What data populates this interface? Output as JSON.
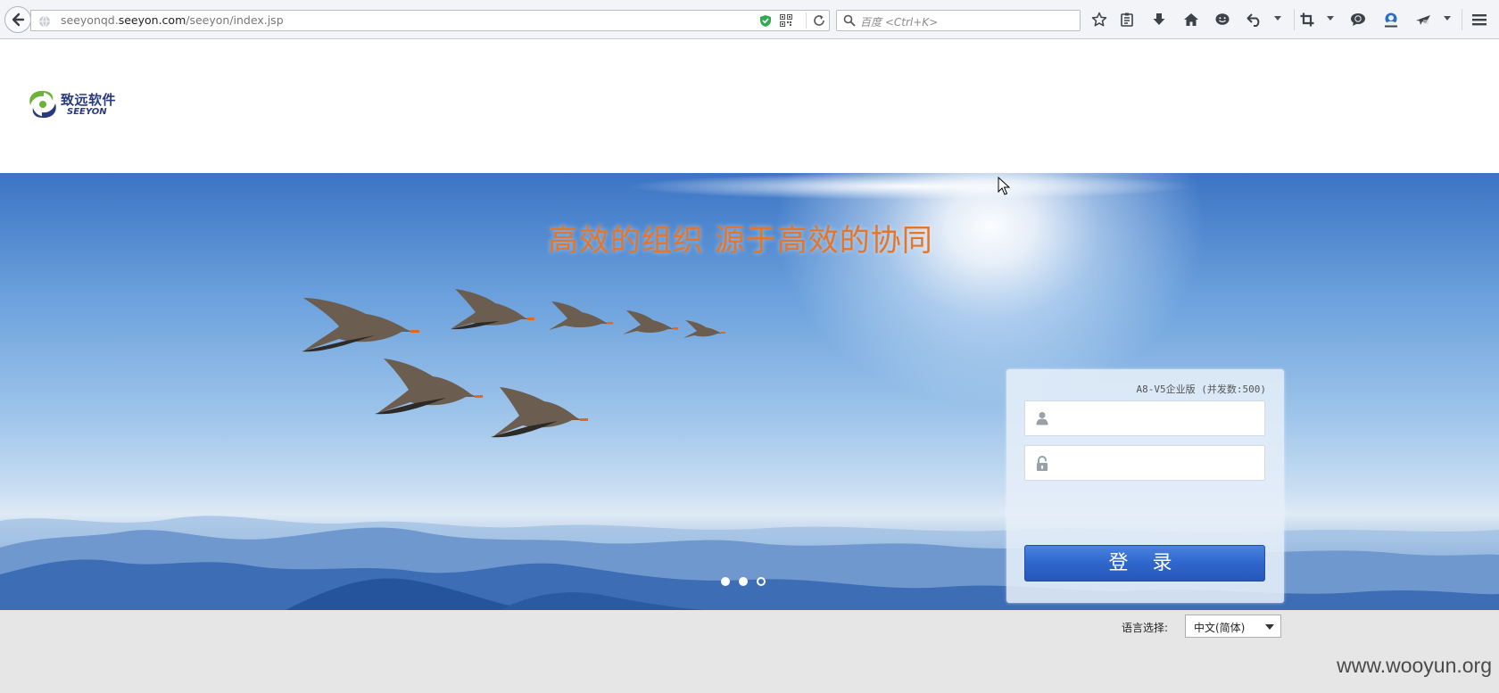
{
  "browser": {
    "url_prefix": "seeyonqd.",
    "url_domain": "seeyon.com",
    "url_path": "/seeyon/index.jsp",
    "search_placeholder": "百度 <Ctrl+K>"
  },
  "header": {
    "logo_cn": "致远软件",
    "logo_en": "SEEYON"
  },
  "banner": {
    "slogan": "高效的组织   源于高效的协同",
    "slide_count": 3,
    "active_slide": 3
  },
  "login": {
    "edition": "A8-V5企业版 (并发数:500)",
    "username_value": "",
    "password_value": "",
    "submit_label": "登 录"
  },
  "footer": {
    "language_label": "语言选择:",
    "language_selected": "中文(简体)",
    "watermark": "www.wooyun.org"
  },
  "colors": {
    "slogan": "#e37628",
    "login_button": "#2f66cc",
    "logo_blue": "#2a3a80",
    "logo_green": "#6bb33a"
  }
}
